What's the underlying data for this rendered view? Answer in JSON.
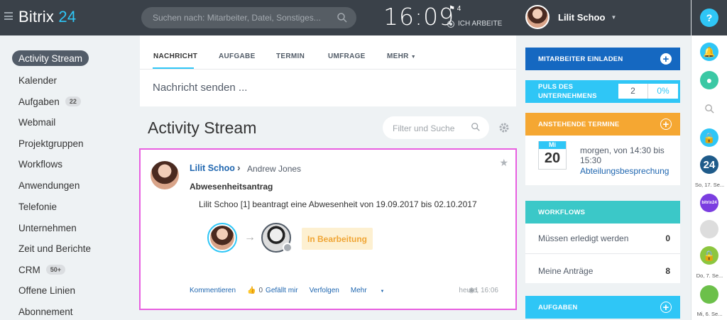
{
  "app": {
    "logo_text": "Bitrix",
    "logo_num": "24"
  },
  "header": {
    "search_placeholder": "Suchen nach: Mitarbeiter, Datei, Sonstiges...",
    "time": "16:09",
    "flag_count": "4",
    "status": "ICH ARBEITE",
    "user_name": "Lilit Schoo"
  },
  "sidebar": {
    "items": [
      {
        "label": "Activity Stream"
      },
      {
        "label": "Kalender"
      },
      {
        "label": "Aufgaben",
        "badge": "22"
      },
      {
        "label": "Webmail"
      },
      {
        "label": "Projektgruppen"
      },
      {
        "label": "Workflows"
      },
      {
        "label": "Anwendungen"
      },
      {
        "label": "Telefonie"
      },
      {
        "label": "Unternehmen"
      },
      {
        "label": "Zeit und Berichte"
      },
      {
        "label": "CRM",
        "badge": "50+"
      },
      {
        "label": "Offene Linien"
      },
      {
        "label": "Abonnement"
      }
    ]
  },
  "composer": {
    "tabs": [
      "NACHRICHT",
      "AUFGABE",
      "TERMIN",
      "UMFRAGE",
      "MEHR"
    ],
    "placeholder": "Nachricht senden ..."
  },
  "stream": {
    "title": "Activity Stream",
    "filter_placeholder": "Filter und Suche"
  },
  "post": {
    "author": "Lilit Schoo",
    "recipient": "Andrew Jones",
    "title": "Abwesenheitsantrag",
    "body": "Lilit Schoo [1] beantragt eine Abwesenheit von 19.09.2017 bis 02.10.2017",
    "status": "In Bearbeitung",
    "actions": {
      "comment": "Kommentieren",
      "likes": "0",
      "like": "Gefällt mir",
      "follow": "Verfolgen",
      "more": "Mehr"
    },
    "views": "1",
    "date": "heute, 16:06"
  },
  "right": {
    "invite": "MITARBEITER EINLADEN",
    "pulse_label_1": "PULS DES",
    "pulse_label_2": "UNTERNEHMENS",
    "pulse_value": "2",
    "pulse_pct": "0%",
    "events_title": "ANSTEHENDE TERMINE",
    "event_weekday": "Mi",
    "event_day": "20",
    "event_time_1": "morgen, von 14:30 bis",
    "event_time_2": "15:30",
    "event_name": "Abteilungsbesprechung",
    "workflows_title": "WORKFLOWS",
    "wf_rows": [
      {
        "label": "Müssen erledigt werden",
        "value": "0"
      },
      {
        "label": "Meine Anträge",
        "value": "8"
      }
    ],
    "tasks_title": "AUFGABEN"
  },
  "rightbar": {
    "help": "?",
    "b24": "24",
    "date1": "So, 17. Se...",
    "date2": "Do, 7. Se...",
    "date3": "Mi, 6. Se..."
  },
  "colors": {
    "accent": "#2fc6f6",
    "header": "#3a4149",
    "invite": "#1568c1",
    "events": "#f5a732",
    "workflows": "#3bc8c8"
  }
}
